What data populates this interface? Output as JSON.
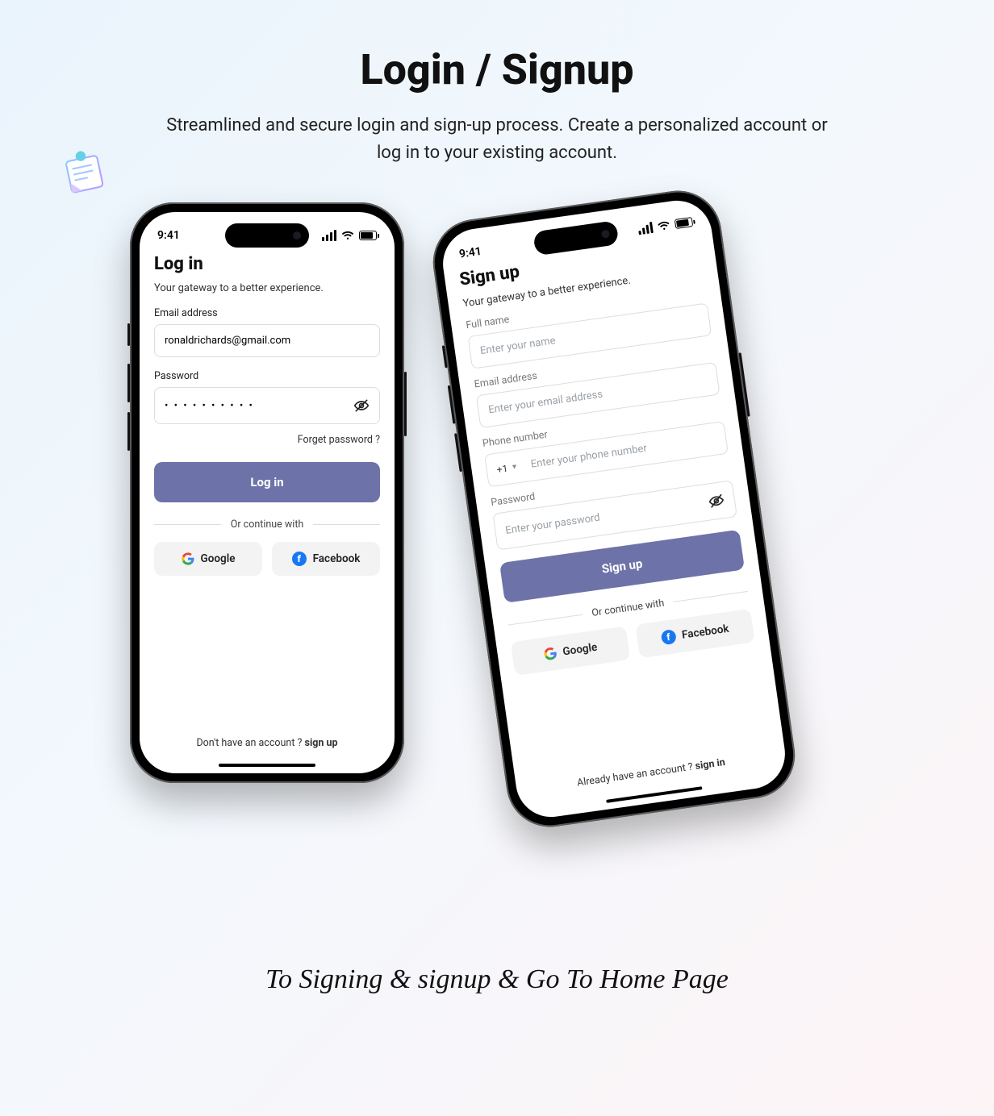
{
  "header": {
    "title": "Login / Signup",
    "subtitle": "Streamlined and secure login and sign-up process. Create a personalized account or log in to your existing account."
  },
  "status_time": "9:41",
  "login": {
    "title": "Log in",
    "tagline": "Your gateway to a better experience.",
    "email_label": "Email address",
    "email_value": "ronaldrichards@gmail.com",
    "password_label": "Password",
    "password_mask": "• • • • • • • • • •",
    "forgot": "Forget password ?",
    "button": "Log in",
    "or": "Or continue with",
    "google": "Google",
    "facebook": "Facebook",
    "no_account_prefix": "Don't have an account ? ",
    "no_account_action": "sign up"
  },
  "signup": {
    "title": "Sign up",
    "tagline": "Your gateway to a better experience.",
    "fullname_label": "Full name",
    "fullname_placeholder": "Enter your name",
    "email_label": "Email address",
    "email_placeholder": "Enter your email address",
    "phone_label": "Phone number",
    "country_code": "+1",
    "phone_placeholder": "Enter your phone number",
    "password_label": "Password",
    "password_placeholder": "Enter your password",
    "button": "Sign up",
    "or": "Or continue with",
    "google": "Google",
    "facebook": "Facebook",
    "have_account_prefix": "Already have an account ? ",
    "have_account_action": "sign in"
  },
  "caption": "To Signing & signup & Go To Home Page"
}
